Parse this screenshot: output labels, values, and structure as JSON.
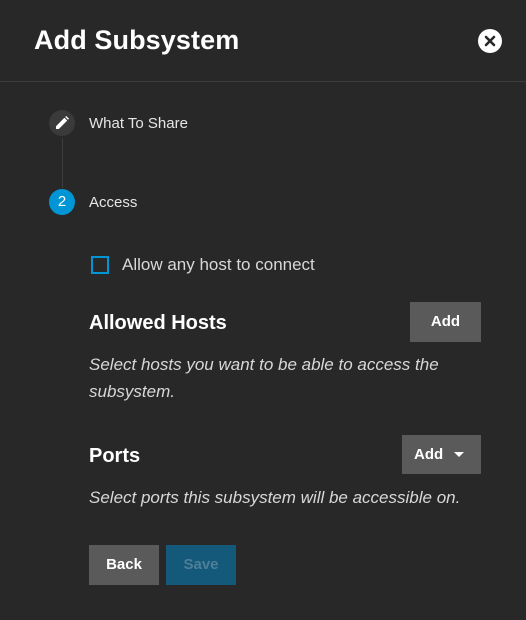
{
  "dialog": {
    "title": "Add Subsystem",
    "close_icon": "close-icon"
  },
  "stepper": {
    "steps": [
      {
        "label": "What To Share",
        "icon": "pencil-icon",
        "state": "completed"
      },
      {
        "label": "Access",
        "number": "2",
        "state": "active"
      }
    ]
  },
  "access": {
    "allow_any_host_label": "Allow any host to connect",
    "allow_any_host_checked": false,
    "allowed_hosts": {
      "title": "Allowed Hosts",
      "add_label": "Add",
      "hint": "Select hosts you want to be able to access the subsystem."
    },
    "ports": {
      "title": "Ports",
      "add_label": "Add",
      "hint": "Select ports this subsystem will be accessible on."
    }
  },
  "actions": {
    "back_label": "Back",
    "save_label": "Save",
    "save_disabled": true
  },
  "colors": {
    "background": "#282828",
    "accent": "#0095d5",
    "button": "#5a5a5a",
    "disabled_primary": "#14587a"
  }
}
